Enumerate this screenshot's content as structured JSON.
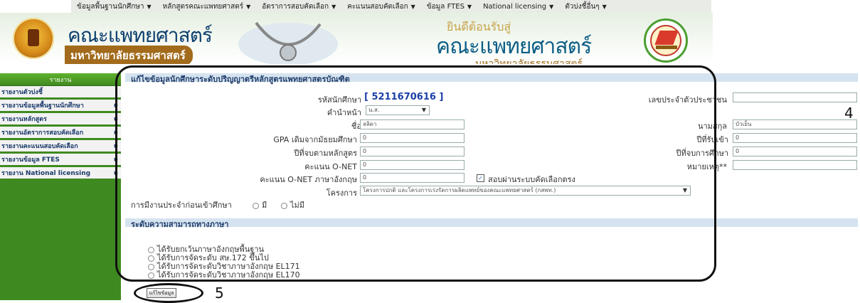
{
  "top_menu": [
    {
      "label": "ข้อมูลพื้นฐานนักศึกษา"
    },
    {
      "label": "หลักสูตรคณะแพทยศาสตร์"
    },
    {
      "label": "อัตราการสอบคัดเลือก"
    },
    {
      "label": "คะแนนสอบคัดเลือก"
    },
    {
      "label": "ข้อมูล FTES"
    },
    {
      "label": "National licensing"
    },
    {
      "label": "ตัวบ่งชี้อื่นๆ"
    }
  ],
  "banner": {
    "title_left": "คณะแพทยศาสตร์",
    "subtitle_left": "มหาวิทยาลัยธรรมศาสตร์",
    "welcome": "ยินดีต้อนรับสู่",
    "title_right": "คณะแพทยศาสตร์",
    "subtitle_right": "มหาวิทยาลัยธรรมศาสตร์"
  },
  "sidebar": {
    "header": "รายงาน",
    "items": [
      {
        "label": "รายงานตัวบ่งชี้",
        "has_submenu": false
      },
      {
        "label": "รายงานข้อมูลพื้นฐานนักศึกษา",
        "has_submenu": true
      },
      {
        "label": "รายงานหลักสูตร",
        "has_submenu": true
      },
      {
        "label": "รายงานอัตราการสอบคัดเลือก",
        "has_submenu": true
      },
      {
        "label": "รายงานคะแนนสอบคัดเลือก",
        "has_submenu": true
      },
      {
        "label": "รายงานข้อมูล FTES",
        "has_submenu": true
      },
      {
        "label": "รายงาน National licensing",
        "has_submenu": true
      }
    ]
  },
  "form": {
    "section_title": "แก้ไขข้อมูลนักศึกษาระดับปริญญาตรีหลักสูตรแพทยศาสตรบัณฑิต",
    "student_id_label": "รหัสนักศึกษา",
    "student_id_value": "[ 5211670616 ]",
    "national_id_label": "เลขประจำตัวประชาชน",
    "national_id_value": "",
    "prefix_label": "คำนำหน้า",
    "prefix_value": "น.ส.",
    "first_name_label": "ชื่อ",
    "first_name_value": "ลลิดา",
    "last_name_label": "นามสกุล",
    "last_name_value": "บัวเย็น",
    "gpa_label": "GPA เดิมจากมัธยมศึกษา",
    "gpa_value": "0",
    "entry_year_label": "ปีที่รับเข้า",
    "entry_year_value": "0",
    "curriculum_end_label": "ปีที่จบตามหลักสูตร",
    "curriculum_end_value": "0",
    "graduation_year_label": "ปีที่จบการศึกษา",
    "graduation_year_value": "0",
    "onet_label": "คะแนน O-NET",
    "onet_value": "0",
    "remark_label": "หมายเหตุ**",
    "remark_value": "",
    "onet_eng_label": "คะแนน O-NET ภาษาอังกฤษ",
    "onet_eng_value": "0",
    "direct_selection_label": "สอบผ่านระบบคัดเลือกตรง",
    "direct_selection_checked": true,
    "project_label": "โครงการ",
    "project_value": "โครงการปกติ และโครงการเร่งรัดการผลิตแพทย์ของคณะแพทยศาสตร์ (กสพท.)",
    "work_experience_label": "การมีงานประจำก่อนเข้าศึกษา",
    "work_yes": "มี",
    "work_no": "ไม่มี"
  },
  "language": {
    "section_title": "ระดับความสามารถทางภาษา",
    "options": [
      "ได้รับยกเว้นภาษาอังกฤษพื้นฐาน",
      "ได้รับการจัดระดับ สษ.172 ขึ้นไป",
      "ได้รับการจัดระดับวิชาภาษาอังกฤษ EL171",
      "ได้รับการจัดระดับวิชาภาษาอังกฤษ EL170"
    ]
  },
  "actions": {
    "save_label": "แก้ไขข้อมูล"
  },
  "annotations": {
    "marker_4": "4",
    "marker_5": "5"
  }
}
